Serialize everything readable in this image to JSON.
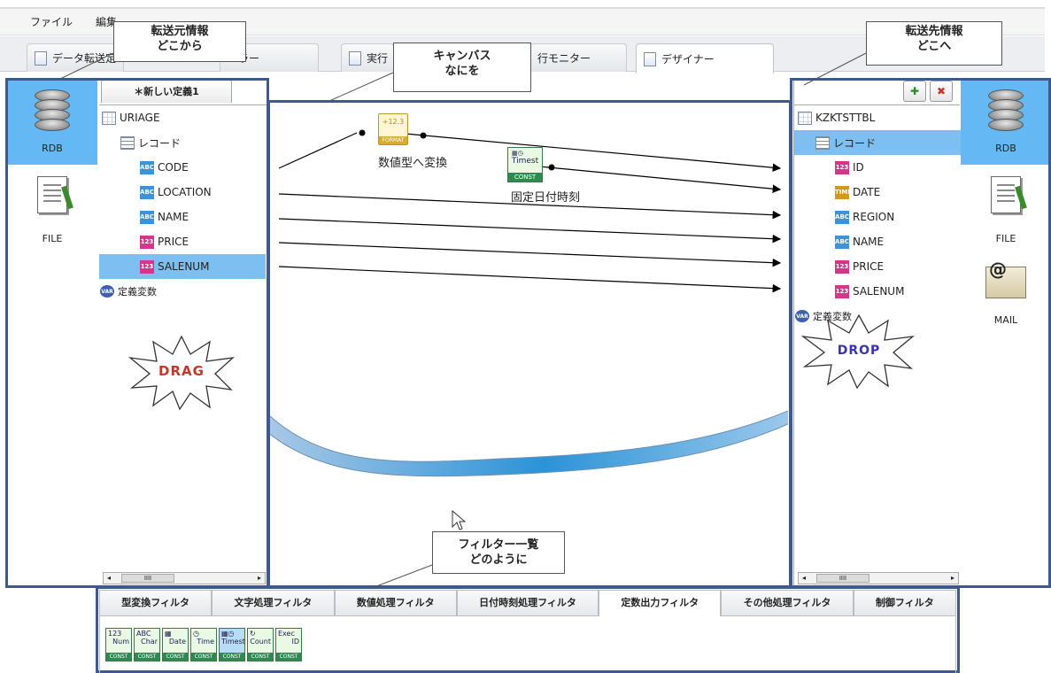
{
  "menu": [
    "ファイル",
    "編集"
  ],
  "tabs": [
    {
      "label": "データ転送定"
    },
    {
      "label": "ーラー"
    },
    {
      "label": "実行"
    },
    {
      "label": "行モニター"
    },
    {
      "label": "デザイナー"
    }
  ],
  "source_types": [
    {
      "label": "RDB",
      "icon": "database-icon",
      "selected": true
    },
    {
      "label": "FILE",
      "icon": "file-icon",
      "selected": false
    }
  ],
  "dest_types": [
    {
      "label": "RDB",
      "icon": "database-icon",
      "selected": true
    },
    {
      "label": "FILE",
      "icon": "file-icon",
      "selected": false
    },
    {
      "label": "MAIL",
      "icon": "mail-icon",
      "selected": false
    }
  ],
  "source": {
    "tab_label": "＊新しい定義1",
    "table": "URIAGE",
    "record": "レコード",
    "fields": [
      {
        "type": "ABC",
        "name": "CODE"
      },
      {
        "type": "ABC",
        "name": "LOCATION"
      },
      {
        "type": "ABC",
        "name": "NAME"
      },
      {
        "type": "123",
        "name": "PRICE"
      },
      {
        "type": "123",
        "name": "SALENUM"
      }
    ],
    "vars": "定義変数"
  },
  "dest": {
    "table": "KZKTSTTBL",
    "record": "レコード",
    "fields": [
      {
        "type": "123",
        "name": "ID"
      },
      {
        "type": "TIME",
        "name": "DATE"
      },
      {
        "type": "ABC",
        "name": "REGION"
      },
      {
        "type": "ABC",
        "name": "NAME"
      },
      {
        "type": "123",
        "name": "PRICE"
      },
      {
        "type": "123",
        "name": "SALENUM"
      }
    ],
    "vars": "定義変数"
  },
  "canvas": {
    "filter1_label": "数値型へ変換",
    "filter1_icon_text": "+12.3",
    "filter1_icon_tag": "FORMAT",
    "filter2_label": "固定日付時刻",
    "filter2_icon_text": "Timest",
    "filter2_icon_tag": "CONST",
    "drag": "DRAG",
    "drop": "DROP"
  },
  "callouts": {
    "source_line1": "転送元情報",
    "source_line2": "どこから",
    "canvas_line1": "キャンバス",
    "canvas_line2": "なにを",
    "dest_line1": "転送先情報",
    "dest_line2": "どこへ",
    "filters_line1": "フィルター一覧",
    "filters_line2": "どのように"
  },
  "filter_tabs": [
    "型変換フィルタ",
    "文字処理フィルタ",
    "数値処理フィルタ",
    "日付時刻処理フィルタ",
    "定数出力フィルタ",
    "その他処理フィルタ",
    "制御フィルタ"
  ],
  "active_filter_tab": 4,
  "filter_icons": [
    {
      "top": "123",
      "label": "Num",
      "tag": "CONST"
    },
    {
      "top": "ABC",
      "label": "Char",
      "tag": "CONST"
    },
    {
      "top": "",
      "label": "Date",
      "tag": "CONST"
    },
    {
      "top": "",
      "label": "Time",
      "tag": "CONST"
    },
    {
      "top": "",
      "label": "Timest",
      "tag": "CONST"
    },
    {
      "top": "",
      "label": "Count",
      "tag": "CONST"
    },
    {
      "top": "Exec",
      "label": "ID",
      "tag": "CONST"
    }
  ],
  "scroll_thumb": "IIII"
}
